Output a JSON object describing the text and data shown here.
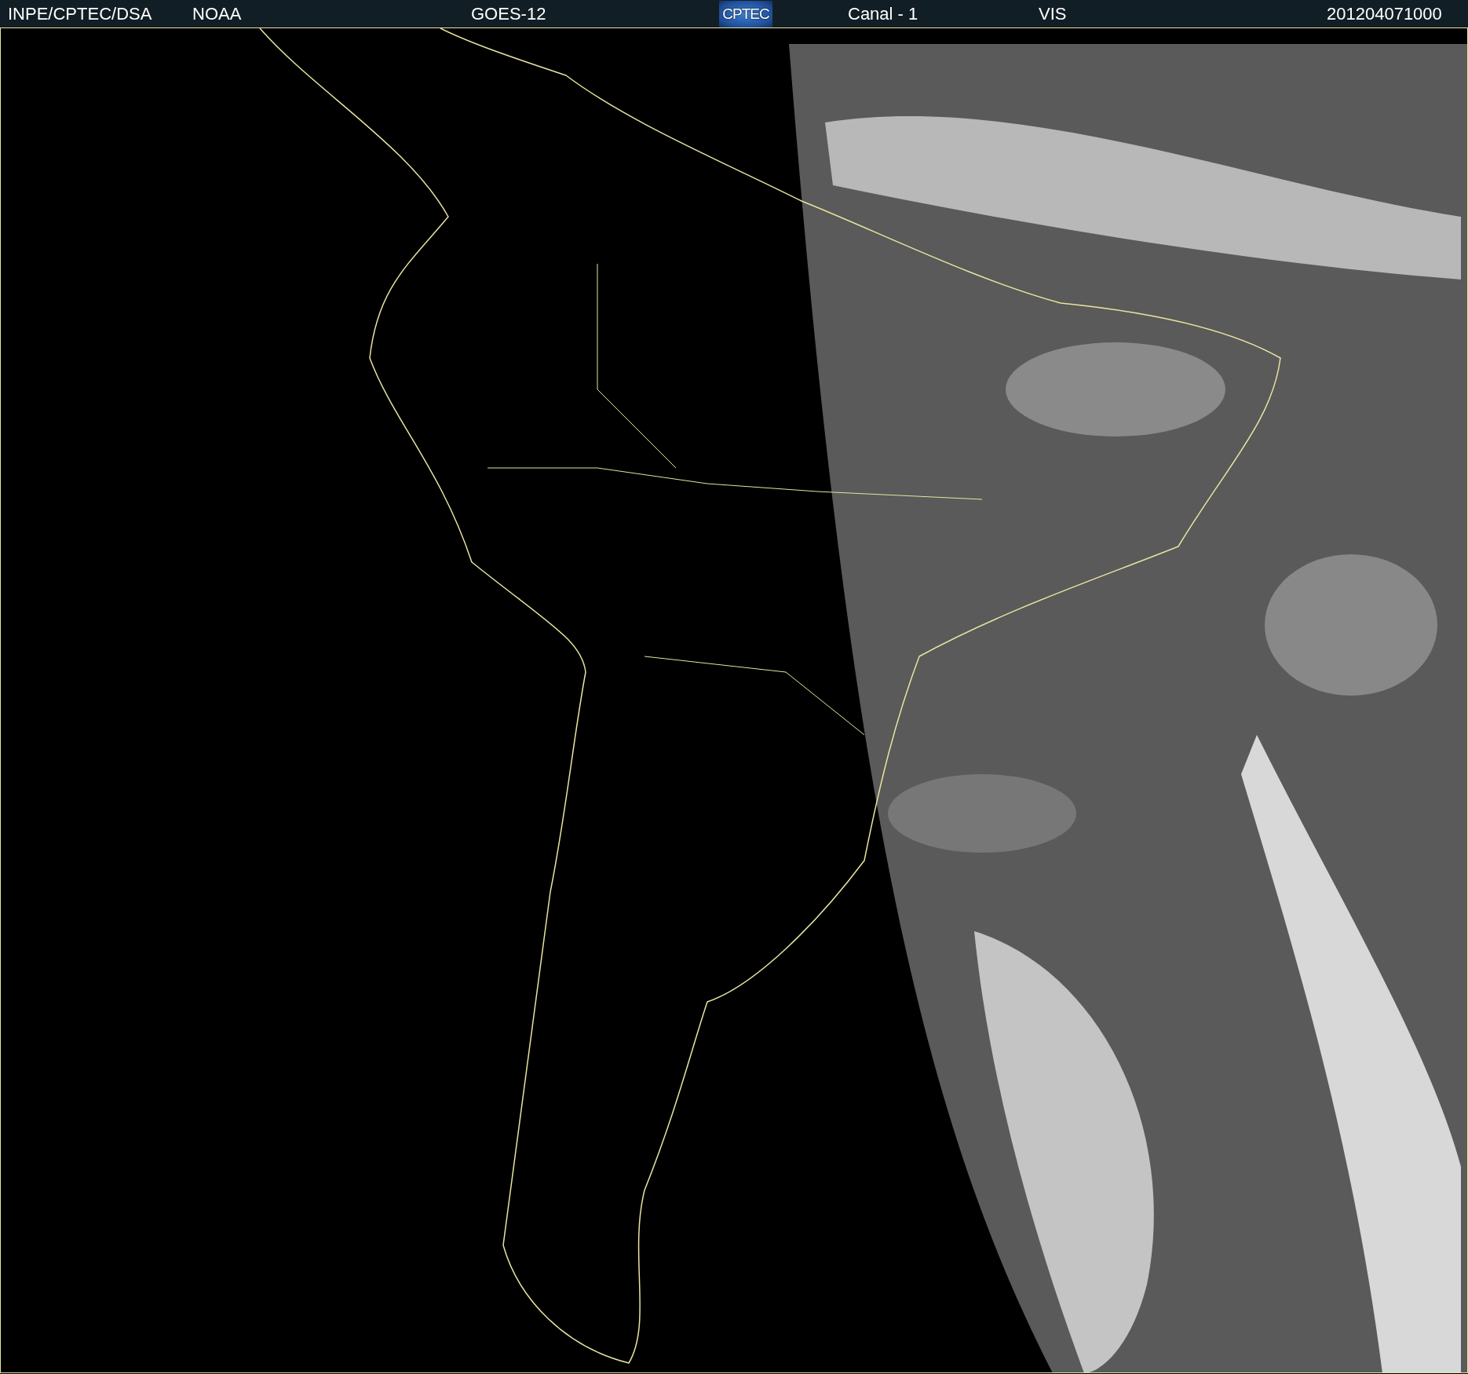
{
  "header": {
    "source": "INPE/CPTEC/DSA",
    "agency": "NOAA",
    "satellite": "GOES-12",
    "logo_text": "CPTEC",
    "channel": "Canal - 1",
    "band": "VIS",
    "timestamp": "201204071000"
  }
}
